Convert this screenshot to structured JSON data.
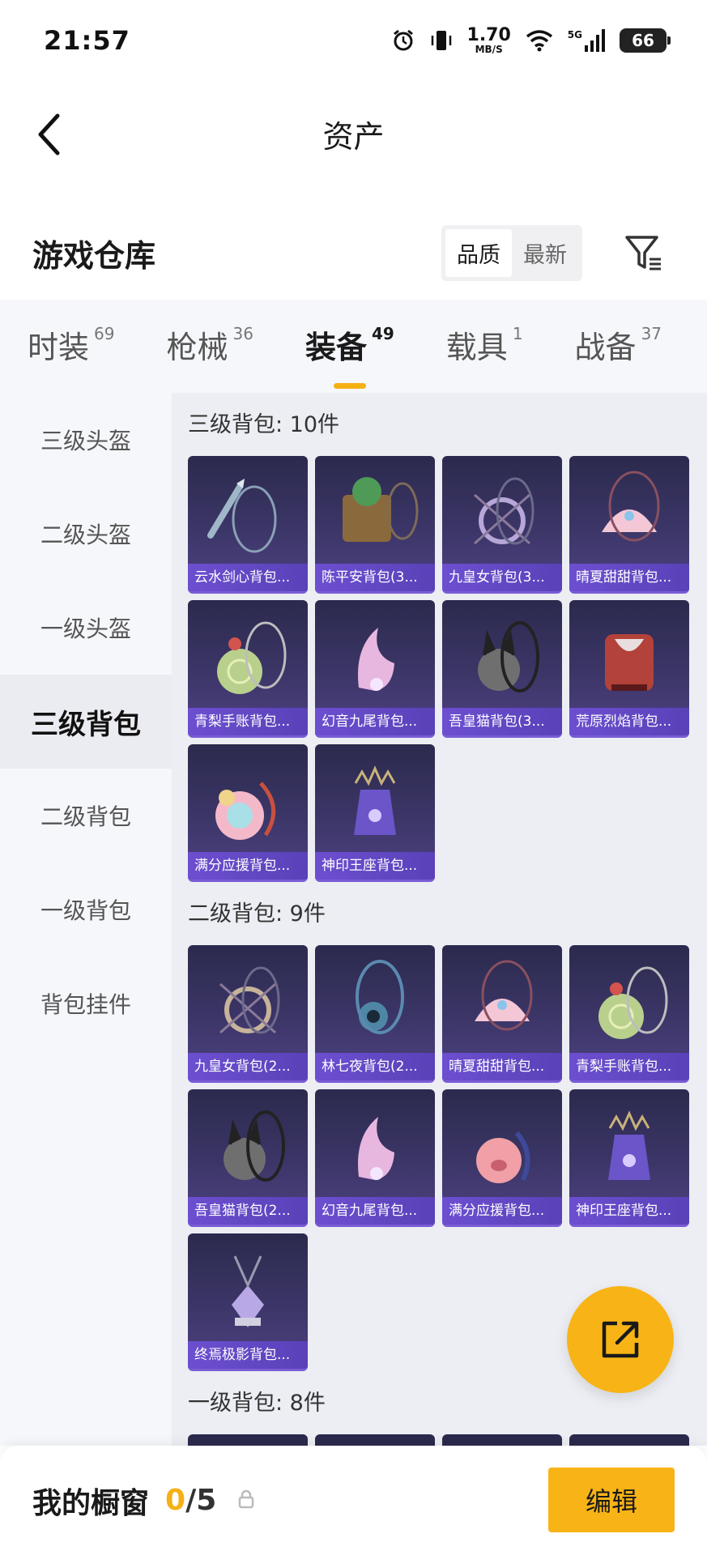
{
  "status_bar": {
    "time": "21:57",
    "net_speed": "1.70",
    "net_unit": "MB/S",
    "signal": "5G",
    "battery": "66"
  },
  "header": {
    "title": "资产"
  },
  "warehouse": {
    "title": "游戏仓库",
    "sort_options": [
      "品质",
      "最新"
    ],
    "sort_selected": "品质"
  },
  "tabs": [
    {
      "label": "时装",
      "count": "69"
    },
    {
      "label": "枪械",
      "count": "36"
    },
    {
      "label": "装备",
      "count": "49",
      "active": true
    },
    {
      "label": "载具",
      "count": "1"
    },
    {
      "label": "战备",
      "count": "37"
    }
  ],
  "sidebar": [
    {
      "label": "三级头盔"
    },
    {
      "label": "二级头盔"
    },
    {
      "label": "一级头盔"
    },
    {
      "label": "三级背包",
      "active": true
    },
    {
      "label": "二级背包"
    },
    {
      "label": "一级背包"
    },
    {
      "label": "背包挂件"
    }
  ],
  "sections": [
    {
      "title": "三级背包: 10件",
      "items": [
        {
          "name": "云水剑心背包...",
          "icon": "sword-backpack-icon",
          "color": "#9fb7c8"
        },
        {
          "name": "陈平安背包(3...",
          "icon": "basket-backpack-icon",
          "color": "#8a6a3c"
        },
        {
          "name": "九皇女背包(3...",
          "icon": "ornate-ring-backpack-icon",
          "color": "#b7a7d8"
        },
        {
          "name": "晴夏甜甜背包...",
          "icon": "shell-backpack-icon",
          "color": "#f3c7d6"
        },
        {
          "name": "青梨手账背包...",
          "icon": "pear-backpack-icon",
          "color": "#b9d08c"
        },
        {
          "name": "幻音九尾背包...",
          "icon": "fox-backpack-icon",
          "color": "#e7b7e0"
        },
        {
          "name": "吾皇猫背包(3...",
          "icon": "cat-backpack-icon",
          "color": "#6f6f6f"
        },
        {
          "name": "荒原烈焰背包...",
          "icon": "flame-backpack-icon",
          "color": "#b3423a"
        },
        {
          "name": "满分应援背包...",
          "icon": "fluffy-backpack-icon",
          "color": "#f4b9c9"
        },
        {
          "name": "神印王座背包...",
          "icon": "throne-backpack-icon",
          "color": "#6b55c9"
        }
      ]
    },
    {
      "title": "二级背包: 9件",
      "items": [
        {
          "name": "九皇女背包(2...",
          "icon": "ornate-ring-backpack-icon",
          "color": "#c6b39a"
        },
        {
          "name": "林七夜背包(2...",
          "icon": "eye-backpack-icon",
          "color": "#4f86a6"
        },
        {
          "name": "晴夏甜甜背包...",
          "icon": "shell-backpack-icon",
          "color": "#f3c7d6"
        },
        {
          "name": "青梨手账背包...",
          "icon": "pear-backpack-icon",
          "color": "#b9d08c"
        },
        {
          "name": "吾皇猫背包(2...",
          "icon": "cat-backpack-icon",
          "color": "#6f6f6f"
        },
        {
          "name": "幻音九尾背包...",
          "icon": "fox-backpack-icon",
          "color": "#e7b7e0"
        },
        {
          "name": "满分应援背包...",
          "icon": "pig-backpack-icon",
          "color": "#f0a0a6"
        },
        {
          "name": "神印王座背包...",
          "icon": "throne-backpack-icon",
          "color": "#6b55c9"
        },
        {
          "name": "终焉极影背包...",
          "icon": "crystal-backpack-icon",
          "color": "#b9a8e6"
        }
      ]
    },
    {
      "title": "一级背包: 8件",
      "items": []
    }
  ],
  "bottom": {
    "showcase_label": "我的橱窗",
    "current": "0",
    "total": "/5",
    "edit_label": "编辑"
  },
  "accent_color": "#f8b416"
}
